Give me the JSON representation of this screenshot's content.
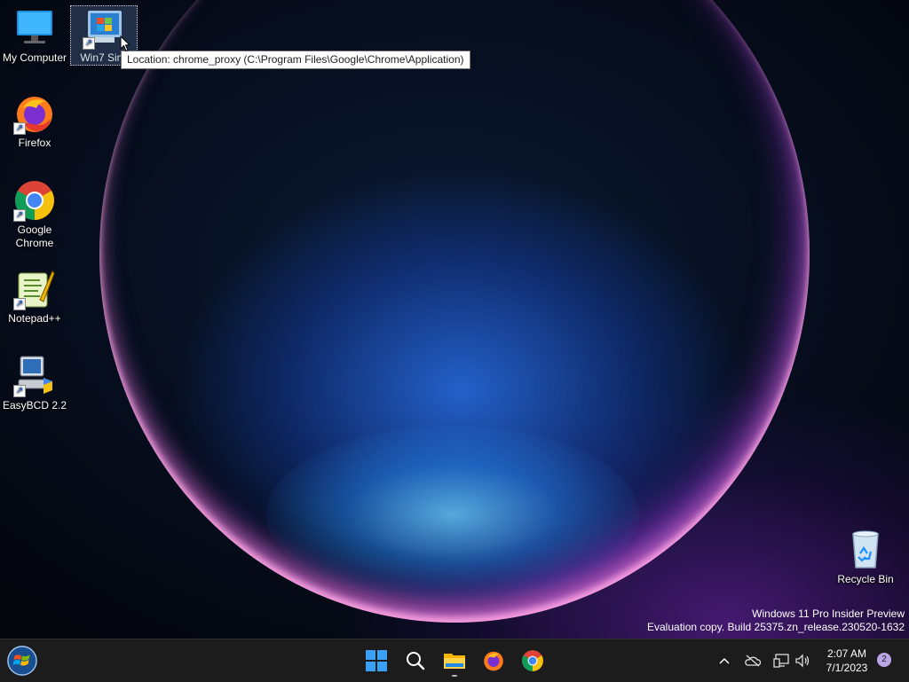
{
  "desktop": {
    "icons": [
      {
        "label": "My Computer"
      },
      {
        "label": "Win7 Sim"
      },
      {
        "label": "Firefox"
      },
      {
        "label": "Google Chrome"
      },
      {
        "label": "Notepad++"
      },
      {
        "label": "EasyBCD 2.2"
      },
      {
        "label": "Recycle Bin"
      }
    ],
    "tooltip": "Location: chrome_proxy (C:\\Program Files\\Google\\Chrome\\Application)",
    "watermark": {
      "line1": "Windows 11 Pro Insider Preview",
      "line2": "Evaluation copy. Build 25375.zn_release.230520-1632"
    }
  },
  "taskbar": {
    "start_icon": "windows7-orb-icon",
    "pinned": [
      "windows-logo-icon",
      "search-icon",
      "file-explorer-icon",
      "firefox-icon",
      "chrome-icon"
    ],
    "tray_icons": [
      "chevron-up-icon",
      "onedrive-offline-icon",
      "network-icon",
      "volume-icon"
    ],
    "time": "2:07 AM",
    "date": "7/1/2023",
    "notification_count": "2"
  },
  "colors": {
    "taskbar_bg": "#1c1c1c",
    "accent": "#1e90ff"
  }
}
